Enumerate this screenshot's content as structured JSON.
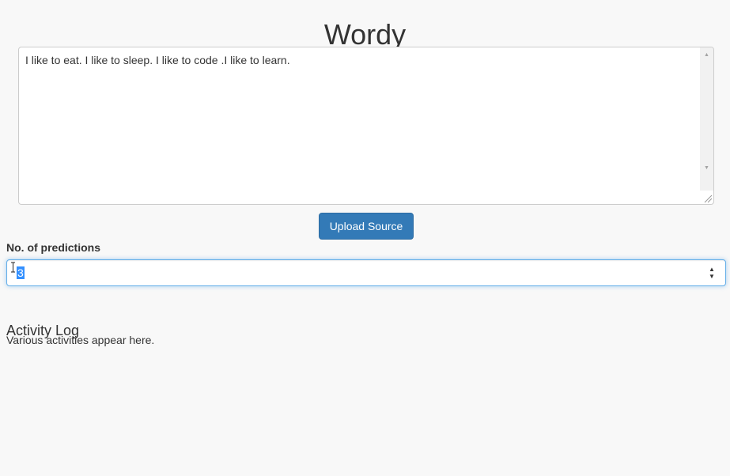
{
  "app": {
    "title": "Wordy"
  },
  "source": {
    "text": "I like to eat. I like to sleep. I like to code .I like to learn."
  },
  "upload": {
    "label": "Upload Source"
  },
  "predictions": {
    "label": "No. of predictions",
    "value": "3"
  },
  "activity_log": {
    "title": "Activity Log",
    "message": "Various activities appear here."
  },
  "colors": {
    "background": "#f8f8f8",
    "primary_button": "#337ab7",
    "focus_border": "#66afe9",
    "selection": "#3390ff",
    "text": "#333333"
  },
  "icons": {
    "scroll_up": "scroll-up-arrow-icon",
    "scroll_down": "scroll-down-arrow-icon",
    "resize": "resize-grip-icon",
    "spin_up": "spin-up-icon",
    "spin_down": "spin-down-icon",
    "cursor": "text-cursor-icon"
  }
}
